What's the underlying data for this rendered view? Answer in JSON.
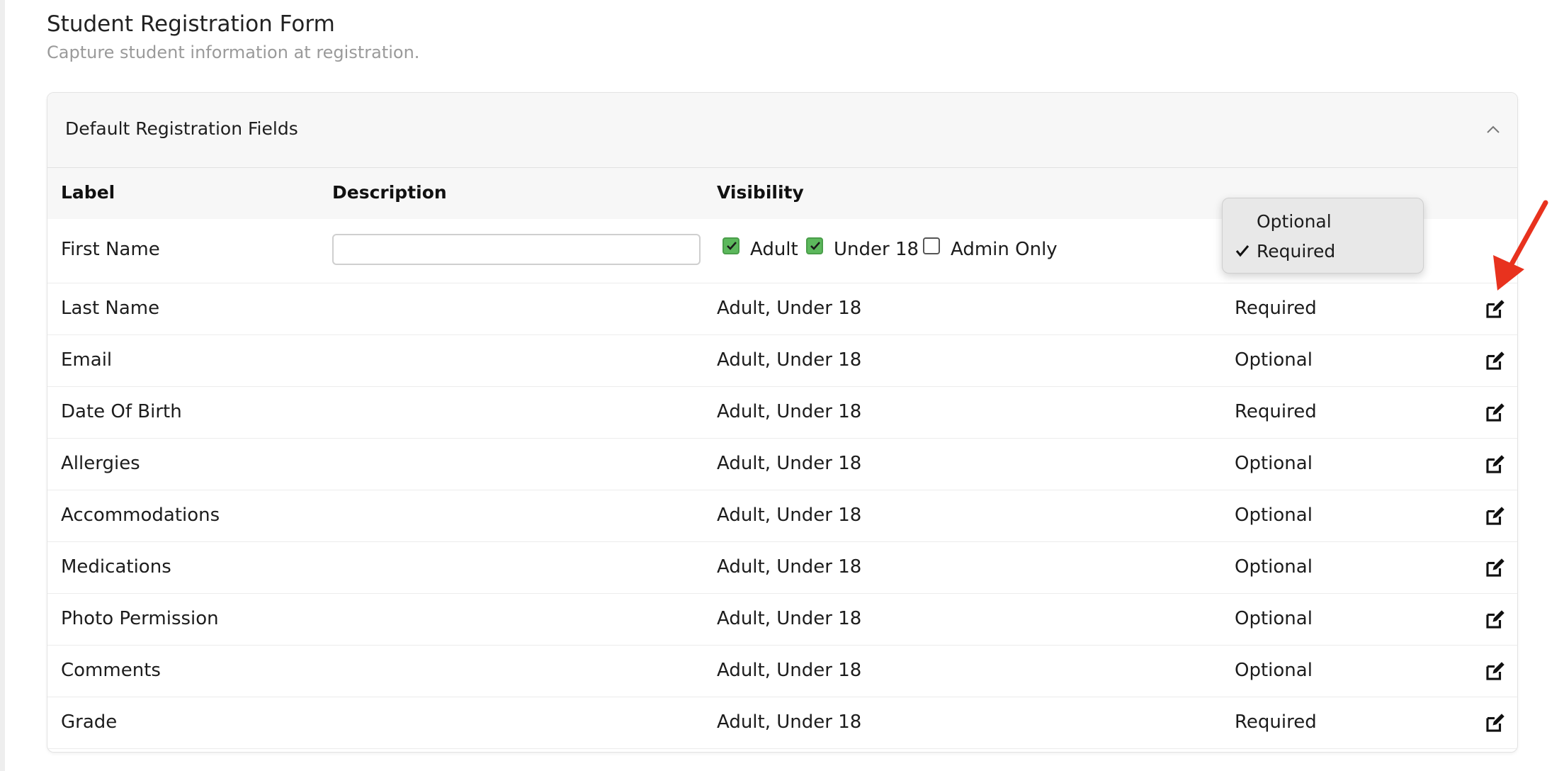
{
  "page": {
    "title": "Student Registration Form",
    "subtitle": "Capture student information at registration."
  },
  "panel": {
    "title": "Default Registration Fields",
    "collapse_icon": "chevron-up-icon"
  },
  "table": {
    "headers": {
      "label": "Label",
      "description": "Description",
      "visibility": "Visibility"
    },
    "editing_row": {
      "label": "First Name",
      "description_value": "",
      "checkboxes": [
        {
          "label": "Adult",
          "checked": true
        },
        {
          "label": "Under 18",
          "checked": true
        },
        {
          "label": "Admin Only",
          "checked": false
        }
      ]
    },
    "rows": [
      {
        "label": "Last Name",
        "visibility": "Adult, Under 18",
        "requirement": "Required"
      },
      {
        "label": "Email",
        "visibility": "Adult, Under 18",
        "requirement": "Optional"
      },
      {
        "label": "Date Of Birth",
        "visibility": "Adult, Under 18",
        "requirement": "Required"
      },
      {
        "label": "Allergies",
        "visibility": "Adult, Under 18",
        "requirement": "Optional"
      },
      {
        "label": "Accommodations",
        "visibility": "Adult, Under 18",
        "requirement": "Optional"
      },
      {
        "label": "Medications",
        "visibility": "Adult, Under 18",
        "requirement": "Optional"
      },
      {
        "label": "Photo Permission",
        "visibility": "Adult, Under 18",
        "requirement": "Optional"
      },
      {
        "label": "Comments",
        "visibility": "Adult, Under 18",
        "requirement": "Optional"
      },
      {
        "label": "Grade",
        "visibility": "Adult, Under 18",
        "requirement": "Required"
      }
    ]
  },
  "dropdown": {
    "options": [
      {
        "label": "Optional",
        "selected": false
      },
      {
        "label": "Required",
        "selected": true
      }
    ]
  },
  "icons": {
    "edit": "edit-icon",
    "check": "check-icon",
    "annotation_arrow": "arrow-icon"
  },
  "colors": {
    "checkbox_checked": "#5cb85c",
    "annotation_arrow": "#e8321e"
  }
}
